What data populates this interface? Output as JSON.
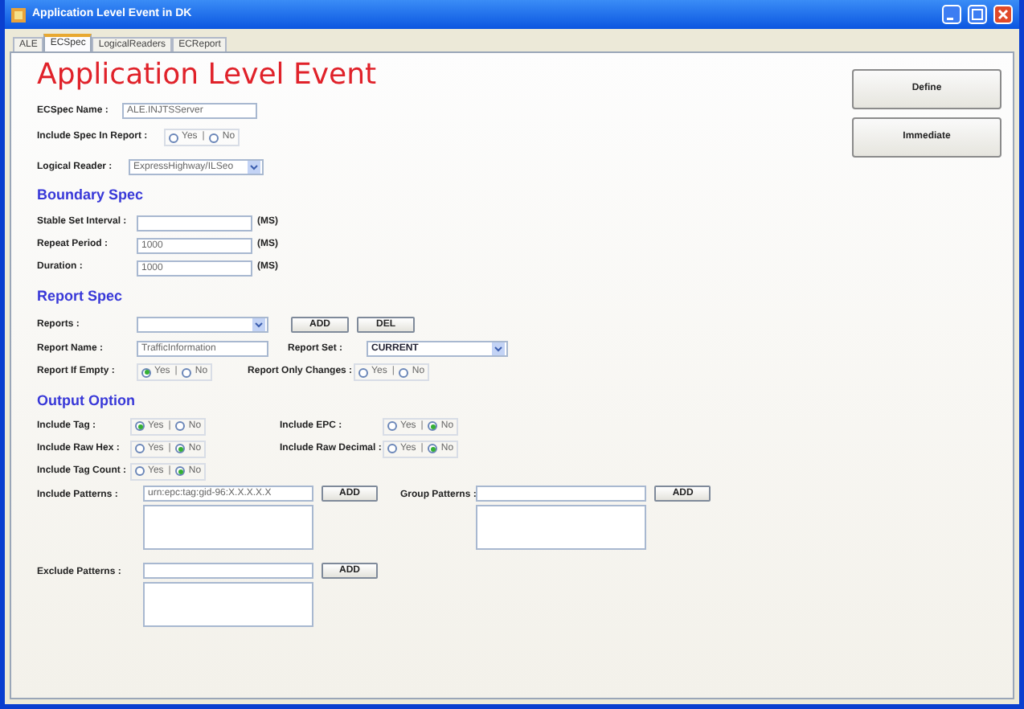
{
  "window": {
    "title": "Application Level Event in DK"
  },
  "tabs": [
    {
      "label": "ALE",
      "selected": false
    },
    {
      "label": "ECSpec",
      "selected": true
    },
    {
      "label": "LogicalReaders",
      "selected": false
    },
    {
      "label": "ECReport",
      "selected": false
    }
  ],
  "heading": "Application Level Event",
  "side_buttons": [
    "Define",
    "Immediate"
  ],
  "ecspec_name": {
    "label": "ECSpec Name :",
    "value": "ALE.INJTSServer"
  },
  "include_spec": {
    "label": "Include Spec In Report :",
    "separator": "|",
    "options": [
      {
        "label": "Yes",
        "selected": false
      },
      {
        "label": "No",
        "selected": false
      }
    ]
  },
  "logical_reader": {
    "label": "Logical Reader :",
    "value": "ExpressHighway/ILSeo"
  },
  "boundary_spec": {
    "title": "Boundary Spec",
    "fields": [
      {
        "label": "Stable Set Interval :",
        "unit": "(MS)"
      },
      {
        "label": "Repeat Period :",
        "value": "1000",
        "unit": "(MS)"
      },
      {
        "label": "Duration :",
        "value": "1000",
        "unit": "(MS)"
      }
    ]
  },
  "report_spec": {
    "title": "Report Spec",
    "reports": {
      "label": "Reports :",
      "buttons": [
        "ADD",
        "DEL"
      ]
    },
    "report_name": {
      "label": "Report Name :",
      "value": "TrafficInformation"
    },
    "report_set": {
      "label": "Report Set :",
      "value": "CURRENT"
    },
    "report_if_empty": {
      "label": "Report If Empty :",
      "separator": "|",
      "options": [
        {
          "label": "Yes",
          "selected": true
        },
        {
          "label": "No",
          "selected": false
        }
      ]
    },
    "report_only_changes": {
      "label": "Report Only Changes :",
      "separator": "|",
      "options": [
        {
          "label": "Yes",
          "selected": false
        },
        {
          "label": "No",
          "selected": false
        }
      ]
    }
  },
  "output_option": {
    "title": "Output Option",
    "rows": [
      [
        {
          "label": "Include Tag :",
          "separator": "|",
          "options": [
            {
              "label": "Yes",
              "selected": true
            },
            {
              "label": "No",
              "selected": false
            }
          ]
        },
        {
          "label": "Include EPC :",
          "separator": "|",
          "options": [
            {
              "label": "Yes",
              "selected": false
            },
            {
              "label": "No",
              "selected": true
            }
          ]
        }
      ],
      [
        {
          "label": "Include Raw Hex :",
          "separator": "|",
          "options": [
            {
              "label": "Yes",
              "selected": false
            },
            {
              "label": "No",
              "selected": true
            }
          ]
        },
        {
          "label": "Include Raw Decimal :",
          "separator": "|",
          "options": [
            {
              "label": "Yes",
              "selected": false
            },
            {
              "label": "No",
              "selected": true
            }
          ]
        }
      ],
      [
        {
          "label": "Include Tag Count :",
          "separator": "|",
          "options": [
            {
              "label": "Yes",
              "selected": false
            },
            {
              "label": "No",
              "selected": true
            }
          ]
        }
      ]
    ],
    "include_patterns": {
      "label": "Include Patterns :",
      "value": "urn:epc:tag:gid-96:X.X.X.X.X",
      "button": "ADD"
    },
    "group_patterns": {
      "label": "Group Patterns :",
      "button": "ADD"
    },
    "exclude_patterns": {
      "label": "Exclude Patterns :",
      "button": "ADD"
    }
  }
}
